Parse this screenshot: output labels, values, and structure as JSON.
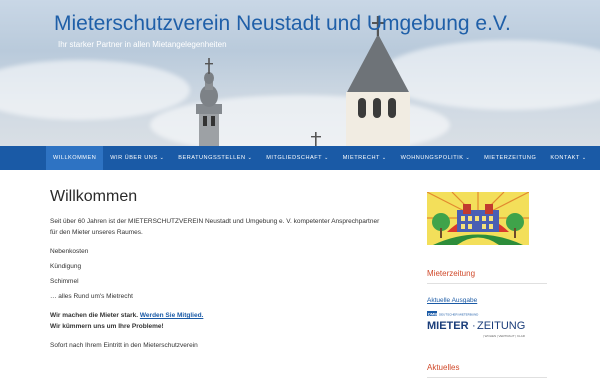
{
  "header": {
    "title": "Mieterschutzverein Neustadt und Umgebung e.V.",
    "tagline": "Ihr starker Partner in allen Mietangelegenheiten"
  },
  "nav": {
    "items": [
      {
        "label": "WILLKOMMEN",
        "has_dropdown": false
      },
      {
        "label": "WIR ÜBER UNS",
        "has_dropdown": true
      },
      {
        "label": "BERATUNGSSTELLEN",
        "has_dropdown": true
      },
      {
        "label": "MITGLIEDSCHAFT",
        "has_dropdown": true
      },
      {
        "label": "MIETRECHT",
        "has_dropdown": true
      },
      {
        "label": "WOHNUNGSPOLITIK",
        "has_dropdown": true
      },
      {
        "label": "MIETERZEITUNG",
        "has_dropdown": false
      },
      {
        "label": "KONTAKT",
        "has_dropdown": true
      }
    ],
    "chevron": "⌄"
  },
  "main": {
    "title": "Willkommen",
    "intro": "Seit über 60 Jahren ist der MIETERSCHUTZVEREIN Neustadt und Umgebung e. V. kompetenter Ansprechpartner für den Mieter unseres Raumes.",
    "topics": [
      "Nebenkosten",
      "Kündigung",
      "Schimmel",
      "… alles Rund um's Mietrecht"
    ],
    "cta_prefix": "Wir machen die Mieter stark.",
    "cta_link": "Werden Sie Mitglied.",
    "cta_second": "Wir kümmern uns um Ihre Probleme!",
    "after_join": "Sofort nach Ihrem Eintritt in den Mieterschutzverein"
  },
  "sidebar": {
    "mieterzeitung_title": "Mieterzeitung",
    "current_issue_link": "Aktuelle Ausgabe",
    "logo_badge": "DMB",
    "logo_badge_sub": "DEUTSCHER MIETERBUND",
    "logo_text_left": "MIETER",
    "logo_text_right": "ZEITUNG",
    "logo_subline": "| WOHEN | VERTRAUT | KLAR",
    "news_title": "Aktuelles"
  },
  "colors": {
    "title_blue": "#1f5fa8",
    "nav_blue": "#1a5aa6",
    "nav_active": "#2e73c3",
    "widget_title": "#d0492a"
  }
}
